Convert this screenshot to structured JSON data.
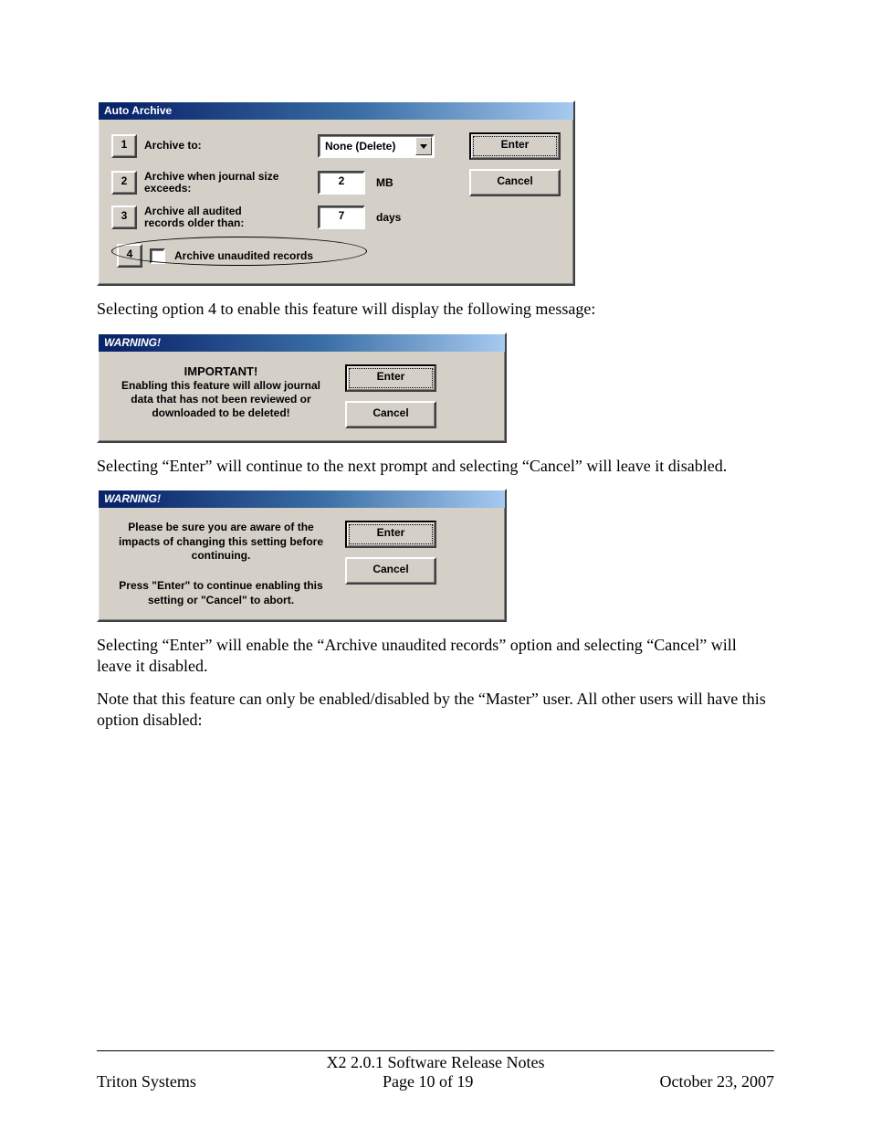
{
  "dialog1": {
    "title": "Auto Archive",
    "rows": [
      {
        "num": "1",
        "label": "Archive to:",
        "value": "None (Delete)"
      },
      {
        "num": "2",
        "label": "Archive when journal size exceeds:",
        "value": "2",
        "unit": "MB"
      },
      {
        "num": "3",
        "label": "Archive all audited records older than:",
        "value": "7",
        "unit": "days"
      }
    ],
    "row4": {
      "num": "4",
      "label": "Archive unaudited records"
    },
    "enter": "Enter",
    "cancel": "Cancel"
  },
  "para1": "Selecting option 4 to enable this feature will display the following message:",
  "dialog2": {
    "title": "WARNING!",
    "heading": "IMPORTANT!",
    "text": "Enabling this feature will allow journal data that has not been reviewed or downloaded to be deleted!",
    "enter": "Enter",
    "cancel": "Cancel"
  },
  "para2": "Selecting “Enter” will continue to the next prompt and selecting “Cancel” will leave it disabled.",
  "dialog3": {
    "title": "WARNING!",
    "text1": "Please be sure you are aware of the impacts of changing this setting before continuing.",
    "text2": "Press \"Enter\" to continue enabling this setting or \"Cancel\" to abort.",
    "enter": "Enter",
    "cancel": "Cancel"
  },
  "para3": "Selecting “Enter” will enable the “Archive unaudited records” option and selecting “Cancel” will leave it disabled.",
  "para4": "Note that this feature can only be enabled/disabled by the “Master” user.  All other users will have this option disabled:",
  "footer": {
    "title": "X2 2.0.1 Software Release Notes",
    "left": "Triton Systems",
    "center": "Page 10 of 19",
    "right": "October 23, 2007"
  }
}
